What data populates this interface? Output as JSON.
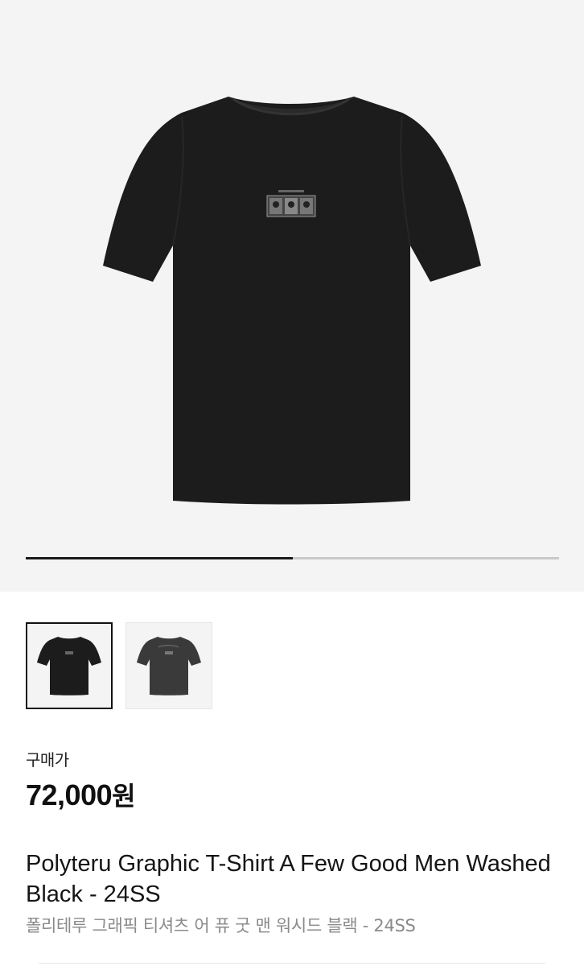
{
  "product": {
    "image_alt": "product-image-main",
    "gallery_progress": 0.5,
    "thumbnails": [
      {
        "name": "thumbnail-black",
        "color": "#1c1c1c",
        "selected": true
      },
      {
        "name": "thumbnail-washed",
        "color": "#3a3a3a",
        "selected": false
      }
    ],
    "price_label": "구매가",
    "price": "72,000",
    "price_unit": "원",
    "title_en": "Polyteru Graphic T-Shirt A Few Good Men Washed Black - 24SS",
    "title_ko": "폴리테루 그래픽 티셔츠 어 퓨 굿 맨 워시드 블랙 - 24SS"
  },
  "colors": {
    "background": "#f4f4f4",
    "shirt": "#1c1c1c",
    "accent": "#111111",
    "muted_text": "#8a8a8a"
  }
}
